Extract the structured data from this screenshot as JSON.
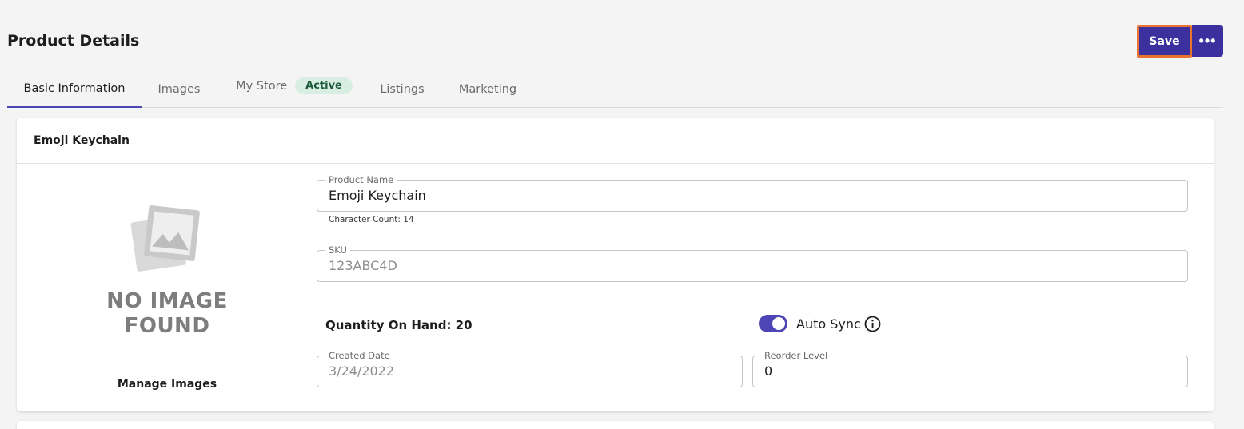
{
  "header": {
    "title": "Product Details",
    "save_label": "Save",
    "more_label": "•••"
  },
  "tabs": [
    {
      "label": "Basic Information",
      "active": true
    },
    {
      "label": "Images"
    },
    {
      "label": "My Store",
      "badge": "Active"
    },
    {
      "label": "Listings"
    },
    {
      "label": "Marketing"
    }
  ],
  "card": {
    "title": "Emoji Keychain",
    "image": {
      "icon": "image-placeholder-icon",
      "placeholder_line1": "NO IMAGE",
      "placeholder_line2": "FOUND",
      "manage_label": "Manage Images"
    },
    "product_name": {
      "label": "Product Name",
      "value": "Emoji Keychain",
      "helper": "Character Count: 14"
    },
    "sku": {
      "label": "SKU",
      "value": "123ABC4D"
    },
    "quantity_on_hand": "Quantity On Hand: 20",
    "auto_sync": {
      "label": "Auto Sync",
      "enabled": true,
      "info_icon": "info-icon"
    },
    "created_date": {
      "label": "Created Date",
      "value": "3/24/2022"
    },
    "reorder_level": {
      "label": "Reorder Level",
      "value": "0"
    }
  },
  "colors": {
    "primary": "#3b309e",
    "highlight_outline": "#e8742f",
    "badge_bg": "#d9eee3",
    "tab_indicator": "#4d44b5"
  }
}
